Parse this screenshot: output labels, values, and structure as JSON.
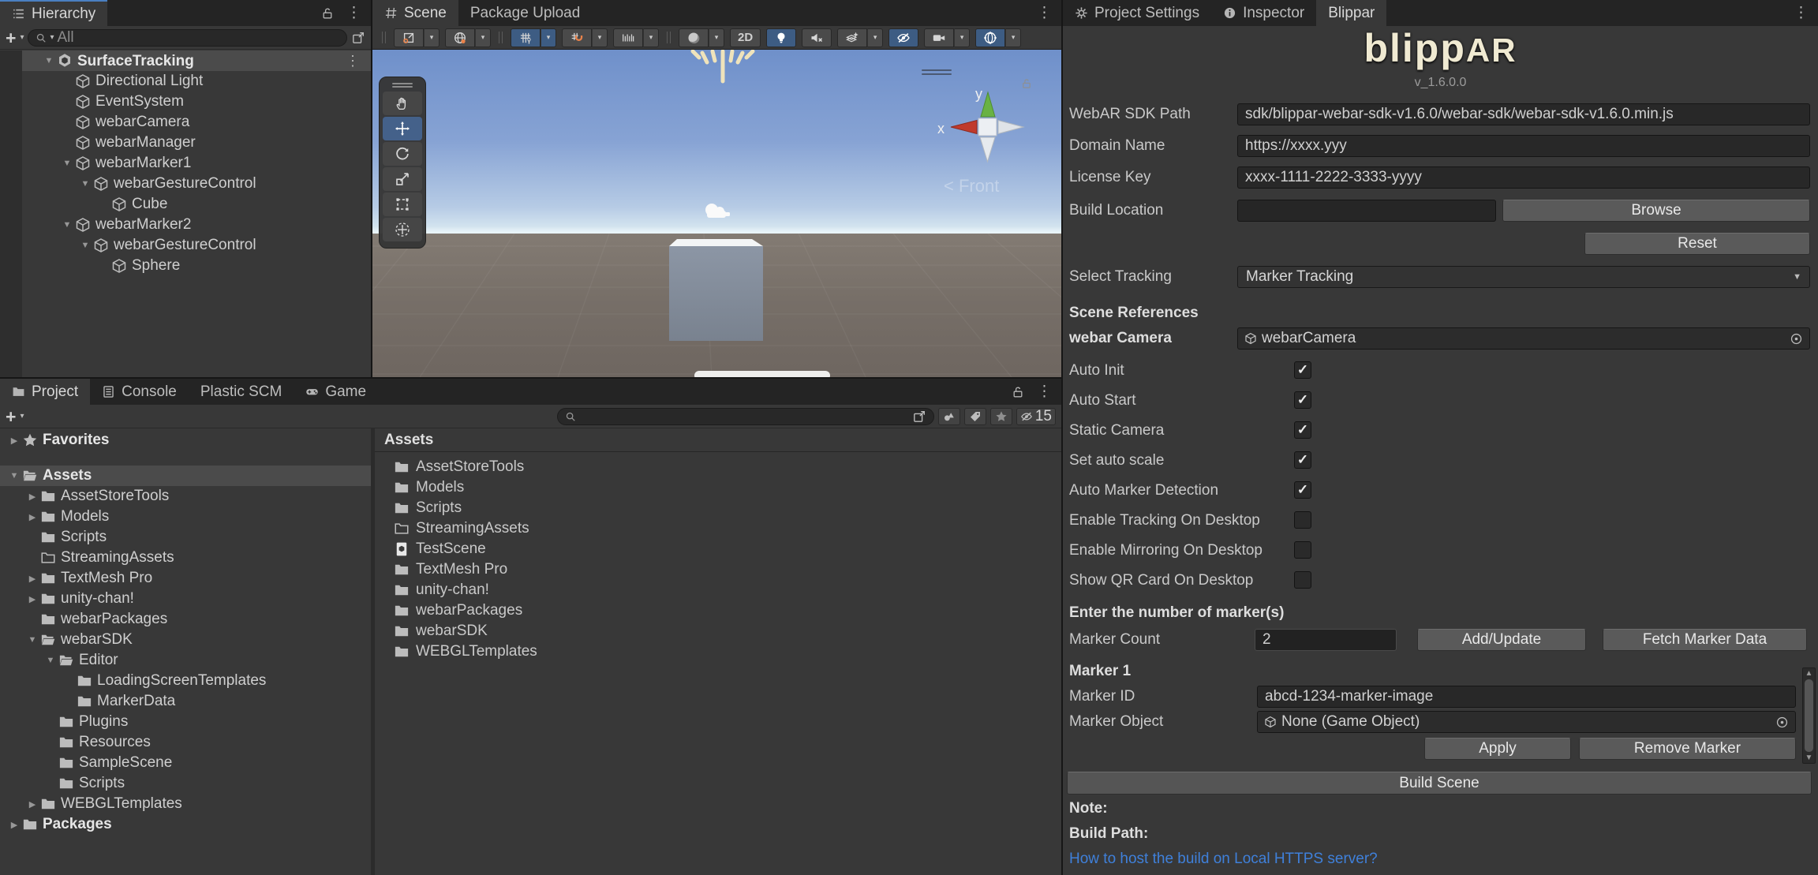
{
  "icons": {
    "kebab": "⋮",
    "caret": "▾",
    "plus": "+",
    "up": "▲",
    "down": "▼",
    "tree_expanded": "▼",
    "tree_collapsed": "▶"
  },
  "hierarchy": {
    "tab_label": "Hierarchy",
    "search_placeholder": "All",
    "items": [
      {
        "label": "SurfaceTracking",
        "indent": 0,
        "arrow": "down",
        "icon": "unity",
        "bold": true,
        "selected": true,
        "kebab": true
      },
      {
        "label": "Directional Light",
        "indent": 1,
        "icon": "cube"
      },
      {
        "label": "EventSystem",
        "indent": 1,
        "icon": "cube"
      },
      {
        "label": "webarCamera",
        "indent": 1,
        "icon": "cube"
      },
      {
        "label": "webarManager",
        "indent": 1,
        "icon": "cube"
      },
      {
        "label": "webarMarker1",
        "indent": 1,
        "arrow": "down",
        "icon": "cube"
      },
      {
        "label": "webarGestureControl",
        "indent": 2,
        "arrow": "down",
        "icon": "cube"
      },
      {
        "label": "Cube",
        "indent": 3,
        "icon": "cube"
      },
      {
        "label": "webarMarker2",
        "indent": 1,
        "arrow": "down",
        "icon": "cube"
      },
      {
        "label": "webarGestureControl",
        "indent": 2,
        "arrow": "down",
        "icon": "cube"
      },
      {
        "label": "Sphere",
        "indent": 3,
        "icon": "cube"
      }
    ]
  },
  "scene_view": {
    "tab_scene": "Scene",
    "tab_package_upload": "Package Upload",
    "btn_2d": "2D",
    "gizmo": {
      "x": "x",
      "y": "y",
      "front": "Front"
    }
  },
  "right_panel": {
    "tab_project_settings": "Project Settings",
    "tab_inspector": "Inspector",
    "tab_blippar": "Blippar",
    "logo_main": "blipp",
    "logo_suffix": "AR",
    "version": "v_1.6.0.0",
    "form": {
      "sdk_path_label": "WebAR SDK Path",
      "sdk_path_value": "sdk/blippar-webar-sdk-v1.6.0/webar-sdk/webar-sdk-v1.6.0.min.js",
      "domain_label": "Domain Name",
      "domain_value": "https://xxxx.yyy",
      "license_label": "License Key",
      "license_value": "xxxx-1111-2222-3333-yyyy",
      "build_location_label": "Build Location",
      "browse_button": "Browse",
      "reset_button": "Reset",
      "select_tracking_label": "Select Tracking",
      "select_tracking_value": "Marker Tracking"
    },
    "scene_references": {
      "header": "Scene References",
      "camera_label": "webar Camera",
      "camera_value": "webarCamera"
    },
    "toggles": [
      {
        "label": "Auto Init",
        "checked": true
      },
      {
        "label": "Auto Start",
        "checked": true
      },
      {
        "label": "Static Camera",
        "checked": true
      },
      {
        "label": "Set auto scale",
        "checked": true
      },
      {
        "label": "Auto Marker Detection",
        "checked": true
      },
      {
        "label": "Enable Tracking On Desktop",
        "checked": false
      },
      {
        "label": "Enable Mirroring On Desktop",
        "checked": false
      },
      {
        "label": "Show QR Card On Desktop",
        "checked": false
      }
    ],
    "markers": {
      "count_header": "Enter the number of marker(s)",
      "count_label": "Marker Count",
      "count_value": "2",
      "add_update_button": "Add/Update",
      "fetch_button": "Fetch Marker Data",
      "marker_header": "Marker 1",
      "id_label": "Marker ID",
      "id_value": "abcd-1234-marker-image",
      "object_label": "Marker Object",
      "object_value": "None (Game Object)",
      "apply_button": "Apply",
      "remove_button": "Remove Marker"
    },
    "build": {
      "build_scene_button": "Build Scene",
      "note_label": "Note:",
      "build_path_label": "Build Path:",
      "link": "How to host the build on Local HTTPS server?"
    }
  },
  "project_panel": {
    "tab_project": "Project",
    "tab_console": "Console",
    "tab_plastic": "Plastic SCM",
    "tab_game": "Game",
    "hidden_count": "15",
    "tree": [
      {
        "label": "Favorites",
        "indent": 0,
        "arrow": "right",
        "icon": "star",
        "bold": true,
        "gap_after": true
      },
      {
        "label": "Assets",
        "indent": 0,
        "arrow": "down",
        "icon": "folder-open",
        "bold": true,
        "selected": true
      },
      {
        "label": "AssetStoreTools",
        "indent": 1,
        "arrow": "right",
        "icon": "folder"
      },
      {
        "label": "Models",
        "indent": 1,
        "arrow": "right",
        "icon": "folder"
      },
      {
        "label": "Scripts",
        "indent": 1,
        "icon": "folder"
      },
      {
        "label": "StreamingAssets",
        "indent": 1,
        "icon": "folder-outline"
      },
      {
        "label": "TextMesh Pro",
        "indent": 1,
        "arrow": "right",
        "icon": "folder"
      },
      {
        "label": "unity-chan!",
        "indent": 1,
        "arrow": "right",
        "icon": "folder"
      },
      {
        "label": "webarPackages",
        "indent": 1,
        "icon": "folder"
      },
      {
        "label": "webarSDK",
        "indent": 1,
        "arrow": "down",
        "icon": "folder-open"
      },
      {
        "label": "Editor",
        "indent": 2,
        "arrow": "down",
        "icon": "folder-open"
      },
      {
        "label": "LoadingScreenTemplates",
        "indent": 3,
        "icon": "folder"
      },
      {
        "label": "MarkerData",
        "indent": 3,
        "icon": "folder"
      },
      {
        "label": "Plugins",
        "indent": 2,
        "icon": "folder"
      },
      {
        "label": "Resources",
        "indent": 2,
        "icon": "folder"
      },
      {
        "label": "SampleScene",
        "indent": 2,
        "icon": "folder"
      },
      {
        "label": "Scripts",
        "indent": 2,
        "icon": "folder"
      },
      {
        "label": "WEBGLTemplates",
        "indent": 1,
        "arrow": "right",
        "icon": "folder"
      },
      {
        "label": "Packages",
        "indent": 0,
        "arrow": "right",
        "icon": "folder",
        "bold": true
      }
    ],
    "assets": {
      "header": "Assets",
      "items": [
        {
          "label": "AssetStoreTools",
          "icon": "folder"
        },
        {
          "label": "Models",
          "icon": "folder"
        },
        {
          "label": "Scripts",
          "icon": "folder"
        },
        {
          "label": "StreamingAssets",
          "icon": "folder-outline"
        },
        {
          "label": "TestScene",
          "icon": "scenefile"
        },
        {
          "label": "TextMesh Pro",
          "icon": "folder"
        },
        {
          "label": "unity-chan!",
          "icon": "folder"
        },
        {
          "label": "webarPackages",
          "icon": "folder"
        },
        {
          "label": "webarSDK",
          "icon": "folder"
        },
        {
          "label": "WEBGLTemplates",
          "icon": "folder"
        }
      ]
    }
  }
}
